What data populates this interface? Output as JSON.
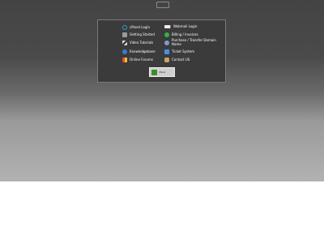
{
  "logo": {
    "icon": "broken-image-icon"
  },
  "left_links": [
    {
      "label": "cPanel Login",
      "icon": "cpanel-icon",
      "color": "#2aa0d8"
    },
    {
      "label": "Getting Started",
      "icon": "book-icon",
      "color": "#9a9a9a"
    },
    {
      "label": "Video Tutorials",
      "icon": "video-icon",
      "color": "#d8d8d8"
    },
    {
      "label": "Knowledgebase",
      "icon": "lightbulb-icon",
      "color": "#3a7bd5"
    },
    {
      "label": "Online Forums",
      "icon": "forums-icon",
      "color": "#e24a3a"
    }
  ],
  "right_links": [
    {
      "label": "Webmail Login",
      "icon": "envelope-icon",
      "color": "#eeeeee"
    },
    {
      "label": "Billing / Invoices",
      "icon": "billing-icon",
      "color": "#36b14a"
    },
    {
      "label": "Purchase / Transfer Domain Name",
      "icon": "globe-icon",
      "color": "#7aa0c8"
    },
    {
      "label": "Ticket System",
      "icon": "ticket-icon",
      "color": "#4a90e2"
    },
    {
      "label": "Contact US",
      "icon": "phone-icon",
      "color": "#c8a46a"
    }
  ],
  "badge": {
    "text": "cPanel"
  }
}
